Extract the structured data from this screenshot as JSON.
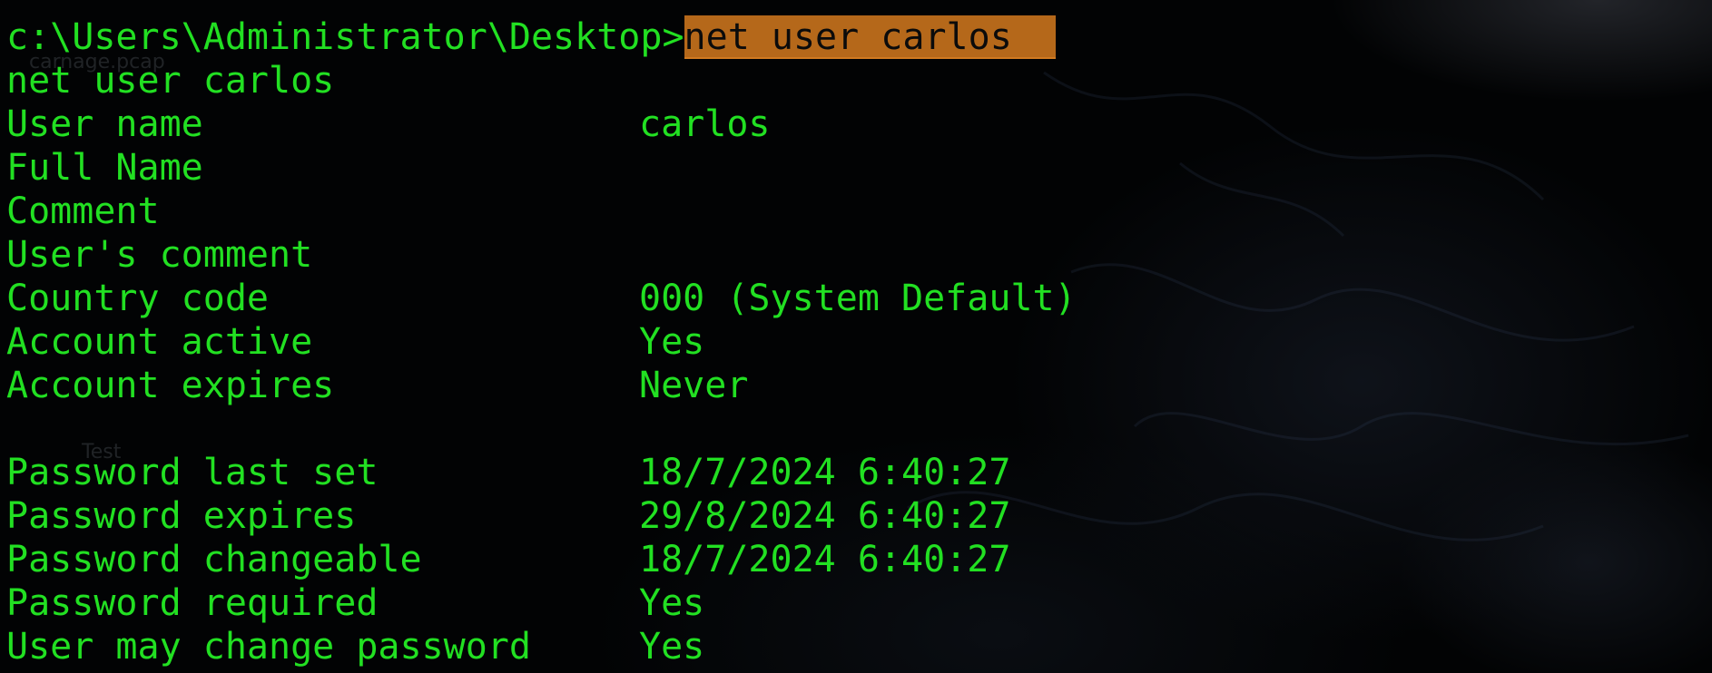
{
  "prompt": {
    "path": "c:\\Users\\Administrator\\Desktop>",
    "command": "net user carlos"
  },
  "echo": "net user carlos",
  "fields": [
    {
      "label": "User name",
      "value": "carlos"
    },
    {
      "label": "Full Name",
      "value": ""
    },
    {
      "label": "Comment",
      "value": ""
    },
    {
      "label": "User's comment",
      "value": ""
    },
    {
      "label": "Country code",
      "value": "000 (System Default)"
    },
    {
      "label": "Account active",
      "value": "Yes"
    },
    {
      "label": "Account expires",
      "value": "Never"
    }
  ],
  "password_fields": [
    {
      "label": "Password last set",
      "value": "18/7/2024 6:40:27"
    },
    {
      "label": "Password expires",
      "value": "29/8/2024 6:40:27"
    },
    {
      "label": "Password changeable",
      "value": "18/7/2024 6:40:27"
    },
    {
      "label": "Password required",
      "value": "Yes"
    },
    {
      "label": "User may change password",
      "value": "Yes"
    }
  ],
  "desktop_ghost": {
    "icon_label_1": "carnage.pcap",
    "icon_label_2": "Test"
  },
  "colors": {
    "text": "#22e022",
    "highlight": "#b5681a",
    "background": "#020304"
  }
}
